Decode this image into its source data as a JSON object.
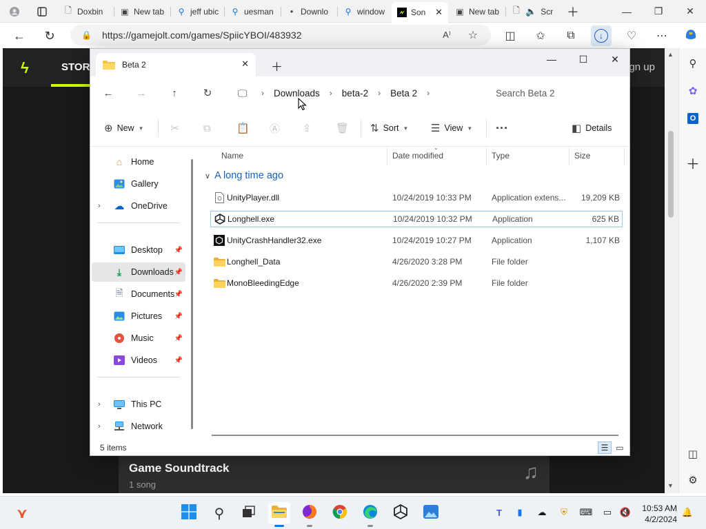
{
  "browser": {
    "tabs": [
      {
        "label": "",
        "icon": "profile-icon"
      },
      {
        "label": "",
        "icon": "tab-actions-icon"
      },
      {
        "label": "Doxbin",
        "icon": "page-icon"
      },
      {
        "label": "New tab",
        "icon": "newtab-icon"
      },
      {
        "label": "jeff ubic",
        "icon": "search-icon"
      },
      {
        "label": "uesman",
        "icon": "search-icon"
      },
      {
        "label": "Downlo",
        "icon": "loading-icon"
      },
      {
        "label": "window",
        "icon": "search-icon"
      },
      {
        "label": "Son",
        "icon": "gamejolt-icon",
        "active": true
      },
      {
        "label": "New tab",
        "icon": "newtab-icon"
      },
      {
        "label": "Scr",
        "icon": "page-icon"
      }
    ],
    "url": "https://gamejolt.com/games/SpiicYBOI/483932"
  },
  "webpage": {
    "nav_store": "STOR",
    "nav_signup": "gn up",
    "card_title": "Game Soundtrack",
    "card_sub": "1 song",
    "accent": "#ccff00"
  },
  "explorer": {
    "tab_title": "Beta 2",
    "breadcrumb": [
      "Downloads",
      "beta-2",
      "Beta 2"
    ],
    "search_placeholder": "Search Beta 2",
    "commands": {
      "new": "New",
      "sort": "Sort",
      "view": "View",
      "details": "Details"
    },
    "nav": {
      "home": "Home",
      "gallery": "Gallery",
      "onedrive": "OneDrive",
      "desktop": "Desktop",
      "downloads": "Downloads",
      "documents": "Documents",
      "pictures": "Pictures",
      "music": "Music",
      "videos": "Videos",
      "thispc": "This PC",
      "network": "Network"
    },
    "columns": {
      "name": "Name",
      "date": "Date modified",
      "type": "Type",
      "size": "Size"
    },
    "group": "A long time ago",
    "files": [
      {
        "name": "UnityPlayer.dll",
        "date": "10/24/2019 10:33 PM",
        "type": "Application extens...",
        "size": "19,209 KB",
        "icon": "dll-file-icon"
      },
      {
        "name": "Longhell.exe",
        "date": "10/24/2019 10:32 PM",
        "type": "Application",
        "size": "625 KB",
        "icon": "unity-app-icon"
      },
      {
        "name": "UnityCrashHandler32.exe",
        "date": "10/24/2019 10:27 PM",
        "type": "Application",
        "size": "1,107 KB",
        "icon": "exe-app-icon"
      },
      {
        "name": "Longhell_Data",
        "date": "4/26/2020 3:28 PM",
        "type": "File folder",
        "size": "",
        "icon": "folder-icon"
      },
      {
        "name": "MonoBleedingEdge",
        "date": "4/26/2020 2:39 PM",
        "type": "File folder",
        "size": "",
        "icon": "folder-icon"
      }
    ],
    "status": "5 items"
  },
  "taskbar": {
    "time": "10:53 AM",
    "date": "4/2/2024"
  }
}
